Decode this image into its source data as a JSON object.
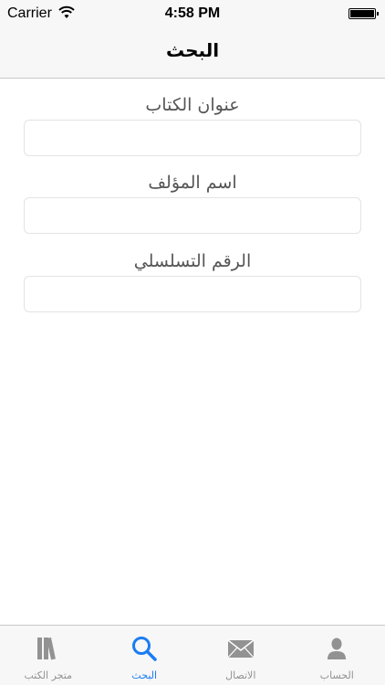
{
  "status_bar": {
    "carrier": "Carrier",
    "time": "4:58 PM"
  },
  "nav": {
    "title": "البحث"
  },
  "form": {
    "fields": [
      {
        "label": "عنوان الكتاب",
        "value": "",
        "placeholder": ""
      },
      {
        "label": "اسم المؤلف",
        "value": "",
        "placeholder": ""
      },
      {
        "label": "الرقم التسلسلي",
        "value": "",
        "placeholder": ""
      }
    ]
  },
  "tab_bar": {
    "active_color": "#1a7cf4",
    "inactive_color": "#929292",
    "tabs": [
      {
        "label": "متجر الكتب",
        "icon": "books-icon",
        "active": false
      },
      {
        "label": "البحث",
        "icon": "search-icon",
        "active": true
      },
      {
        "label": "الاتصال",
        "icon": "envelope-icon",
        "active": false
      },
      {
        "label": "الحساب",
        "icon": "person-icon",
        "active": false
      }
    ]
  }
}
